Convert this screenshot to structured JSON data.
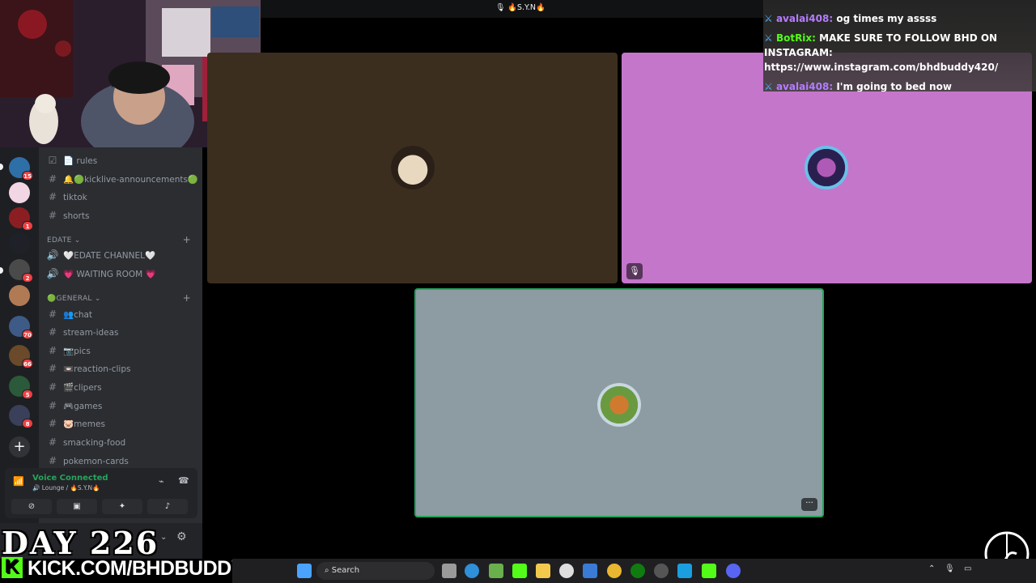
{
  "topbar": {
    "title": "🎙 🔥S.Y.N🔥"
  },
  "sidebar": {
    "channels_top": [
      {
        "icon": "rules-icon",
        "label": "📄 rules"
      },
      {
        "icon": "hash-icon",
        "label": "🔔🟢kicklive-announcements🟢"
      },
      {
        "icon": "hash-icon",
        "label": "tiktok"
      },
      {
        "icon": "hash-icon",
        "label": "shorts"
      }
    ],
    "category_edate": "EDATE ⌄",
    "edate_channels": [
      {
        "icon": "speaker-icon",
        "label": "🤍EDATE CHANNEL🤍"
      },
      {
        "icon": "speaker-icon",
        "label": "💗 WAITING ROOM 💗"
      }
    ],
    "category_general": "🟢GENERAL ⌄",
    "general_channels": [
      {
        "label": "👥chat"
      },
      {
        "label": "stream-ideas"
      },
      {
        "label": "📷pics"
      },
      {
        "label": "📼reaction-clips"
      },
      {
        "label": "🎬clipers"
      },
      {
        "label": "🎮games"
      },
      {
        "label": "🐷memes"
      },
      {
        "label": "smacking-food"
      },
      {
        "label": "pokemon-cards"
      }
    ]
  },
  "server_badges": [
    "15",
    "1",
    "2",
    "70",
    "66",
    "5",
    "8"
  ],
  "voice": {
    "status": "Voice Connected",
    "location": "🔊 Lounge / 🔥S.Y.N🔥"
  },
  "chat": {
    "messages": [
      {
        "user": "avalai408:",
        "text": "og times my assss",
        "user_color": "#b47cff"
      },
      {
        "user": "BotRix:",
        "text": "MAKE SURE TO FOLLOW BHD ON",
        "user_color": "#53fc18"
      },
      {
        "user": "",
        "text": "INSTAGRAM:",
        "user_color": "#ffffff"
      },
      {
        "user": "",
        "text": "https://www.instagram.com/bhdbuddy420/",
        "user_color": "#ffffff"
      },
      {
        "user": "avalai408:",
        "text": "I'm going to bed now",
        "user_color": "#b47cff"
      }
    ]
  },
  "overlay": {
    "day": "DAY 226",
    "kick": "KICK.COM/BHDBUDDY",
    "kick_logo": "K"
  },
  "taskbar": {
    "search_placeholder": "Search"
  },
  "colors": {
    "accent_green": "#23a55a",
    "kick_green": "#53fc18",
    "tile2_bg": "#c476cb"
  }
}
